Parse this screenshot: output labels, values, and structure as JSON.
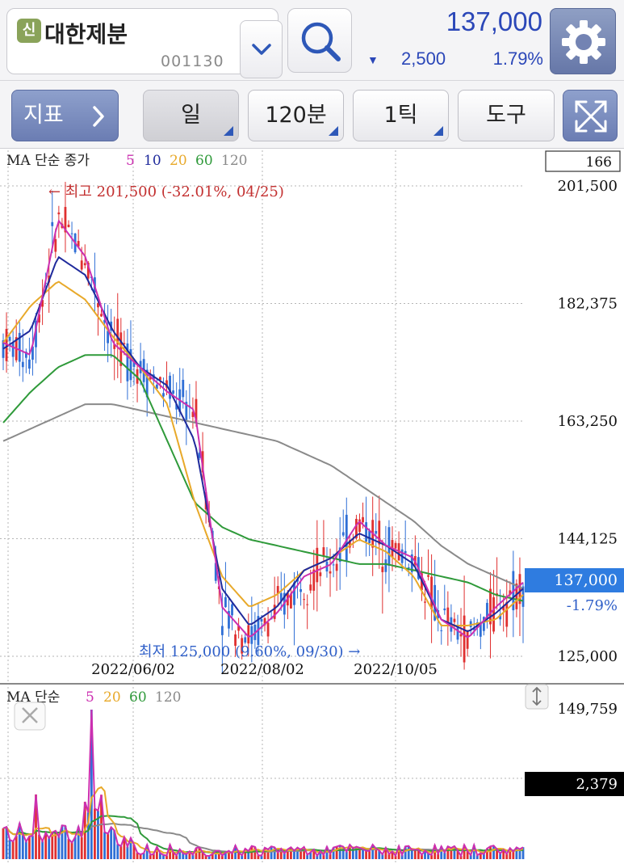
{
  "header": {
    "badge": "신",
    "stock_name": "대한제분",
    "stock_code": "001130",
    "price": "137,000",
    "change_arrow": "▼",
    "change_value": "2,500",
    "change_percent": "1.79%",
    "price_color": "#2b47b8"
  },
  "toolbar": {
    "indicator_label": "지표",
    "period_day": "일",
    "period_minute": "120분",
    "period_tick": "1틱",
    "tools_label": "도구"
  },
  "price_chart": {
    "legend_prefix": "MA 단순 종가",
    "ma_periods": [
      "5",
      "10",
      "20",
      "60",
      "120"
    ],
    "ma_colors": [
      "#cc2fb0",
      "#1f2a9c",
      "#e8a92a",
      "#2f9a3a",
      "#8a8a8a"
    ],
    "count_box": "166",
    "high_note": "← 최고 201,500 (-32.01%, 04/25)",
    "low_note": "최저 125,000 (9.60%, 09/30) →",
    "current_price_tag": "137,000",
    "current_change_tag": "-1.79%",
    "up_color": "#e03030",
    "down_color": "#2f6fd6"
  },
  "volume_chart": {
    "legend_prefix": "MA 단순",
    "ma_periods": [
      "5",
      "20",
      "60",
      "120"
    ],
    "ma_colors": [
      "#cc2fb0",
      "#e8a92a",
      "#2f9a3a",
      "#8a8a8a"
    ],
    "max_label": "149,759",
    "current_volume": "2,379"
  },
  "chart_data": {
    "type": "line",
    "title": "",
    "y_axis_ticks": [
      "201,500",
      "182,375",
      "163,250",
      "144,125",
      "125,000"
    ],
    "ylim": [
      125000,
      201500
    ],
    "x_axis_ticks": [
      "2022/06/02",
      "2022/08/02",
      "2022/10/05"
    ],
    "series": [
      {
        "name": "5",
        "color": "#cc2fb0",
        "values": [
          176000,
          174000,
          196000,
          190000,
          176000,
          172000,
          168000,
          165000,
          133000,
          128000,
          132000,
          138000,
          140000,
          147000,
          143000,
          141000,
          131000,
          128000,
          133000,
          137000
        ]
      },
      {
        "name": "10",
        "color": "#1f2a9c",
        "values": [
          175000,
          178000,
          190000,
          187000,
          178000,
          172000,
          169000,
          160000,
          136000,
          130000,
          133000,
          139000,
          141000,
          145000,
          143000,
          140000,
          131000,
          129000,
          132000,
          136000
        ]
      },
      {
        "name": "20",
        "color": "#e8a92a",
        "values": [
          176000,
          182000,
          186000,
          183000,
          177000,
          172000,
          166000,
          150000,
          138000,
          133000,
          135000,
          139000,
          141000,
          144000,
          142000,
          138000,
          130000,
          130000,
          131000,
          135000
        ]
      },
      {
        "name": "60",
        "color": "#2f9a3a",
        "values": [
          163000,
          168000,
          172000,
          174000,
          174000,
          170000,
          160000,
          150000,
          146000,
          144000,
          143000,
          142000,
          141000,
          140000,
          140000,
          139000,
          138000,
          137000,
          135000,
          134000
        ]
      },
      {
        "name": "120",
        "color": "#8a8a8a",
        "values": [
          160000,
          162000,
          164000,
          166000,
          166000,
          165000,
          164000,
          163000,
          162000,
          161000,
          160000,
          158000,
          156000,
          153000,
          150000,
          147000,
          143000,
          140000,
          138000,
          136000
        ]
      }
    ]
  }
}
